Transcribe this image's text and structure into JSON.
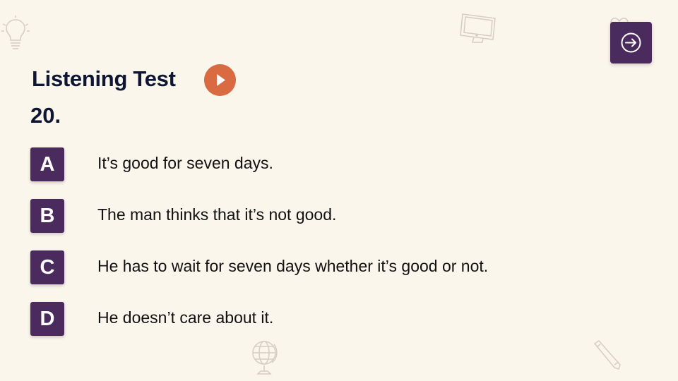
{
  "header": {
    "title": "Listening Test",
    "question_number": "20.",
    "play_icon": "play-icon",
    "next_icon": "arrow-right-circle-icon"
  },
  "options": [
    {
      "letter": "A",
      "text": "It’s good for seven days."
    },
    {
      "letter": "B",
      "text": "The man thinks that it’s not good."
    },
    {
      "letter": "C",
      "text": "He has to wait for seven days whether it’s good or not."
    },
    {
      "letter": "D",
      "text": "He doesn’t care about it."
    }
  ],
  "colors": {
    "background": "#fbf6ec",
    "accent_purple": "#4b2a5e",
    "play_orange": "#d96a42",
    "title_navy": "#0e1633"
  },
  "decorations": [
    "lightbulb-icon",
    "monitor-icon",
    "heart-icon",
    "globe-icon",
    "pencil-icon"
  ]
}
